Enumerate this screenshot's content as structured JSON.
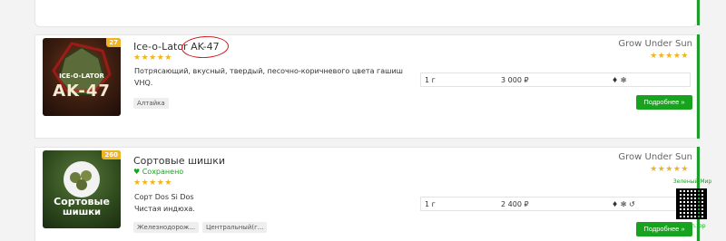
{
  "cards": [
    {
      "badge": "27",
      "image_title_1": "ICE-O-LATOR",
      "image_title_2": "AK-47",
      "title_prefix": "Ice-o-Lator ",
      "title_highlight": "AK-47",
      "stars": "★★★★★",
      "description_line1": "Потрясающий, вкусный, твердый, песочно-коричневого цвета гашиш",
      "description_line2": "VHQ.",
      "tags": [
        "Алтайка"
      ],
      "brand": "Grow Under Sun",
      "brand_stars": "★★★★★",
      "weight": "1 г",
      "price": "3 000 ₽",
      "icons": "♦ ✻",
      "more_button": "Подробнее »"
    },
    {
      "badge": "260",
      "image_title_1": "Сортовые",
      "image_title_2": "шишки",
      "title": "Сортовые шишки",
      "saved": "Сохранено",
      "stars": "★★★★★",
      "description_line1": "Сорт Dos Si Dos",
      "description_line2": "Чистая индюха.",
      "tags": [
        "Железнодорож...",
        "Центральный(г..."
      ],
      "brand": "Grow Under Sun",
      "brand_stars": "★★★★★",
      "weight": "1 г",
      "price": "2 400 ₽",
      "icons": "♦ ✻ ↺",
      "more_button": "Подробнее »"
    }
  ],
  "qr": {
    "top_label": "Зеленый Мир",
    "bottom_label": "green.top"
  },
  "colors": {
    "accent": "#17a31e",
    "star": "#f0b323",
    "annotation": "#d0171b"
  }
}
